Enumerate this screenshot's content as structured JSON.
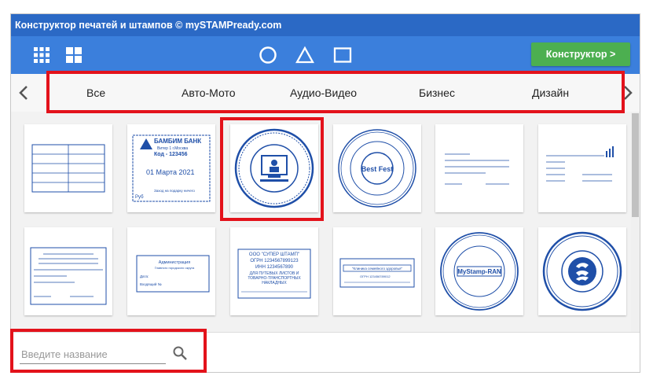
{
  "window": {
    "title": "Конструктор печатей и штампов © mySTAMPready.com"
  },
  "toolbar": {
    "icons": [
      "grid-small-icon",
      "grid-large-icon",
      "circle-icon",
      "triangle-icon",
      "square-icon"
    ],
    "constructor_label": "Конструктор >"
  },
  "categories": {
    "items": [
      "Все",
      "Авто-Мото",
      "Аудио-Видео",
      "Бизнес",
      "Дизайн"
    ],
    "prev_icon": "chevron-left-icon",
    "next_icon": "chevron-right-icon"
  },
  "stamps": {
    "bank_name": "БАМБИМ БАНК",
    "bank_line1": "Витер 1 г.Москва",
    "bank_code": "Код - 123456",
    "bank_date": "01 Марта 2021",
    "bank_footer": "Заход на подарку ничего",
    "bank_rub": "Руб",
    "bestfest": "Best Fest",
    "super_line1": "ООО \"СУПЕР ШТАМП\"",
    "super_line2": "ОГРН 1234567899123",
    "super_line3": "ИНН 1234567890",
    "super_line4": "ДЛЯ ПУТЕВЫХ ЛИСТОВ И",
    "super_line5": "ТОВАРНО-ТРАНСПОРТНЫХ",
    "super_line6": "НАКЛАДНЫХ",
    "mystamp": "MyStamp-RAN",
    "health": "\"Клиника семейного здоровья\"",
    "health_ogrn": "ОГРН 123456789012",
    "admin": "Администрация",
    "admin_sub": "Главного городского округа",
    "admin_date": "Дата:",
    "admin_num": "Входящий №"
  },
  "search": {
    "placeholder": "Введите название",
    "value": ""
  },
  "colors": {
    "titlebar": "#2b69c5",
    "toolbar": "#3b7fdc",
    "accent_green": "#4caf50",
    "highlight_red": "#e3121b",
    "stamp_blue": "#1f4fa8"
  }
}
